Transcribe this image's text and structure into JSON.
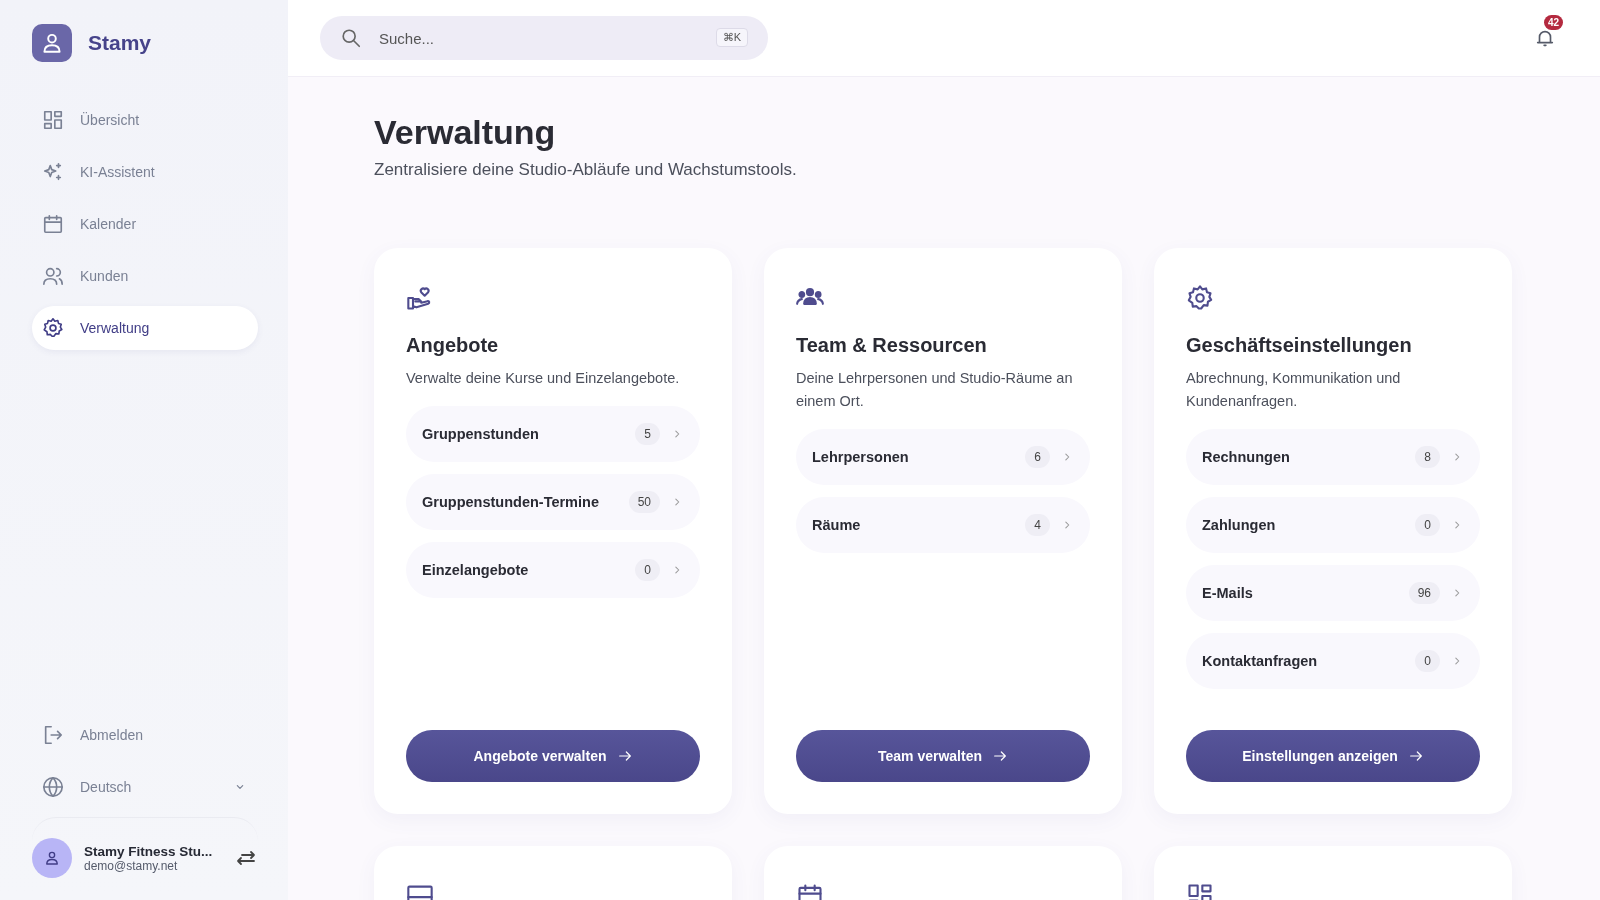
{
  "brand": {
    "name": "Stamy"
  },
  "nav": [
    {
      "label": "Übersicht",
      "kind": "grid",
      "selected": false
    },
    {
      "label": "KI-Assistent",
      "kind": "sparkle",
      "selected": false
    },
    {
      "label": "Kalender",
      "kind": "calendar",
      "selected": false
    },
    {
      "label": "Kunden",
      "kind": "users",
      "selected": false
    },
    {
      "label": "Verwaltung",
      "kind": "gear",
      "selected": true
    }
  ],
  "logout": {
    "label": "Abmelden"
  },
  "language": {
    "label": "Deutsch"
  },
  "account": {
    "name": "Stamy Fitness Stu...",
    "email": "demo@stamy.net"
  },
  "search": {
    "placeholder": "Suche...",
    "shortcut": "⌘K"
  },
  "notifications": {
    "count": "42"
  },
  "page": {
    "title": "Verwaltung",
    "subtitle": "Zentralisiere deine Studio-Abläufe und Wachstumstools."
  },
  "cards": [
    {
      "kind": "hand-heart",
      "title": "Angebote",
      "description": "Verwalte deine Kurse und Einzelangebote.",
      "items": [
        {
          "label": "Gruppenstunden",
          "count": "5"
        },
        {
          "label": "Gruppenstunden-Termine",
          "count": "50"
        },
        {
          "label": "Einzelangebote",
          "count": "0"
        }
      ],
      "button": "Angebote verwalten"
    },
    {
      "kind": "team",
      "title": "Team & Ressourcen",
      "description": "Deine Lehrpersonen und Studio-Räume an einem Ort.",
      "items": [
        {
          "label": "Lehrpersonen",
          "count": "6"
        },
        {
          "label": "Räume",
          "count": "4"
        }
      ],
      "button": "Team verwalten"
    },
    {
      "kind": "gear",
      "title": "Geschäftseinstellungen",
      "description": "Abrechnung, Kommunikation und Kundenanfragen.",
      "items": [
        {
          "label": "Rechnungen",
          "count": "8"
        },
        {
          "label": "Zahlungen",
          "count": "0"
        },
        {
          "label": "E-Mails",
          "count": "96"
        },
        {
          "label": "Kontaktanfragen",
          "count": "0"
        }
      ],
      "button": "Einstellungen anzeigen"
    },
    {
      "kind": "monitor"
    },
    {
      "kind": "calendar"
    },
    {
      "kind": "grid"
    }
  ]
}
